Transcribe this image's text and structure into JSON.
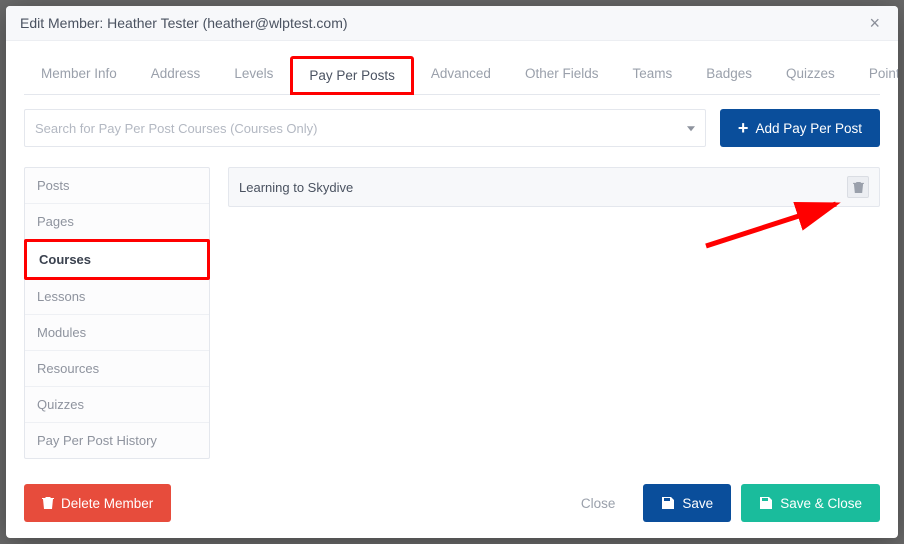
{
  "header": {
    "title": "Edit Member: Heather Tester (heather@wlptest.com)"
  },
  "tabs": [
    {
      "label": "Member Info"
    },
    {
      "label": "Address"
    },
    {
      "label": "Levels"
    },
    {
      "label": "Pay Per Posts",
      "active": true,
      "highlight": true
    },
    {
      "label": "Advanced"
    },
    {
      "label": "Other Fields"
    },
    {
      "label": "Teams"
    },
    {
      "label": "Badges"
    },
    {
      "label": "Quizzes"
    },
    {
      "label": "Points"
    }
  ],
  "search": {
    "placeholder": "Search for Pay Per Post Courses (Courses Only)"
  },
  "buttons": {
    "add": "Add Pay Per Post",
    "delete_member": "Delete Member",
    "close": "Close",
    "save": "Save",
    "save_close": "Save & Close"
  },
  "sidenav": [
    {
      "label": "Posts"
    },
    {
      "label": "Pages"
    },
    {
      "label": "Courses",
      "active": true,
      "highlight": true
    },
    {
      "label": "Lessons"
    },
    {
      "label": "Modules"
    },
    {
      "label": "Resources"
    },
    {
      "label": "Quizzes"
    },
    {
      "label": "Pay Per Post History"
    }
  ],
  "courses": [
    {
      "title": "Learning to Skydive"
    }
  ],
  "colors": {
    "primary": "#0a4e9b",
    "danger": "#e74c3c",
    "success": "#1abc9c",
    "highlight": "#ff0000"
  }
}
